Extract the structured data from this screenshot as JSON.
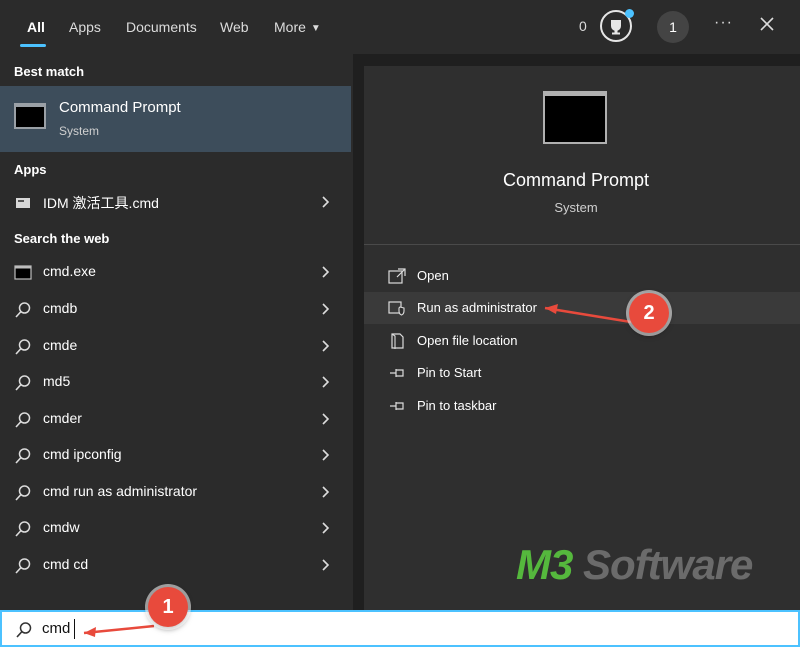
{
  "tabs": [
    {
      "label": "All"
    },
    {
      "label": "Apps"
    },
    {
      "label": "Documents"
    },
    {
      "label": "Web"
    },
    {
      "label": "More"
    }
  ],
  "header": {
    "points": "0",
    "avatar_initial": "1",
    "more_options": "···"
  },
  "best_match": {
    "section": "Best match",
    "title": "Command Prompt",
    "subtitle": "System"
  },
  "apps": {
    "section": "Apps",
    "items": [
      {
        "label": "IDM 激活工具.cmd"
      }
    ]
  },
  "web": {
    "section": "Search the web",
    "items": [
      {
        "label": "cmd.exe"
      },
      {
        "label": "cmdb"
      },
      {
        "label": "cmde"
      },
      {
        "label": "md5"
      },
      {
        "label": "cmder"
      },
      {
        "label": "cmd ipconfig"
      },
      {
        "label": "cmd run as administrator"
      },
      {
        "label": "cmdw"
      },
      {
        "label": "cmd cd"
      }
    ]
  },
  "preview": {
    "title": "Command Prompt",
    "subtitle": "System",
    "actions": [
      {
        "label": "Open"
      },
      {
        "label": "Run as administrator"
      },
      {
        "label": "Open file location"
      },
      {
        "label": "Pin to Start"
      },
      {
        "label": "Pin to taskbar"
      }
    ]
  },
  "search": {
    "value": "cmd"
  },
  "callouts": [
    "1",
    "2"
  ],
  "watermark": {
    "part1": "M3",
    "part2": " Software"
  },
  "colors": {
    "accent": "#4cc2ff",
    "selected_row": "#3d4d5b",
    "callout": "#e84a3c",
    "watermark_green": "#55b83d"
  }
}
